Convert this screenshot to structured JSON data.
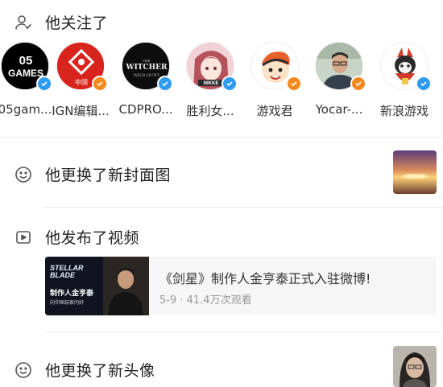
{
  "sections": {
    "followed_title": "他关注了",
    "cover_title": "他更换了新封面图",
    "video_title": "他发布了视频",
    "avatar_title": "他更换了新头像"
  },
  "follows": [
    {
      "name": "05gam...",
      "avatar_text": "05 GAMES",
      "badge": "blue"
    },
    {
      "name": "IGN编辑...",
      "avatar_text": "中国",
      "badge": "orange"
    },
    {
      "name": "CDPRO...",
      "avatar_text": "THE WITCHER",
      "badge": "blue"
    },
    {
      "name": "胜利女...",
      "avatar_text": "NIKKE",
      "badge": "blue"
    },
    {
      "name": "游戏君",
      "avatar_text": "",
      "badge": "orange"
    },
    {
      "name": "Yocar-...",
      "avatar_text": "",
      "badge": "orange"
    },
    {
      "name": "新浪游戏",
      "avatar_text": "",
      "badge": "blue"
    }
  ],
  "video": {
    "title": "《剑星》制作人金亨泰正式入驻微博!",
    "meta": "5-9 · 41.4万次观看",
    "thumb_logo": "STELLAR BLADE",
    "thumb_caption": "制作人金亨泰",
    "thumb_sub": "向中国玩家问好"
  },
  "colors": {
    "badge_blue": "#2d9bf0",
    "badge_orange": "#f5891d",
    "divider": "#ececec"
  }
}
